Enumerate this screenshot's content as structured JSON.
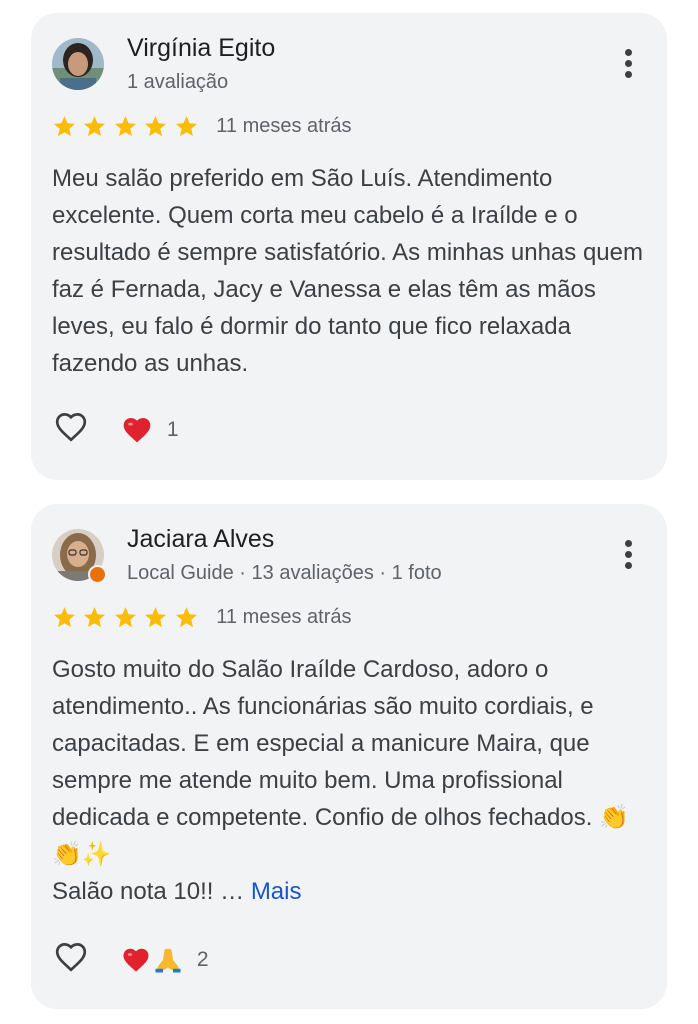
{
  "reviews": [
    {
      "author": "Virgínia Egito",
      "meta": "1 avaliação",
      "rating": 5,
      "date": "11 meses atrás",
      "text": "Meu salão preferido em São Luís. Atendimento excelente. Quem corta meu cabelo é a Iraílde e o resultado é sempre satisfatório. As minhas unhas quem faz é Fernada, Jacy e Vanessa e elas têm as mãos leves, eu falo é dormir do tanto que fico relaxada fazendo as unhas.",
      "reactions": [
        "red-heart"
      ],
      "reaction_count": "1",
      "icons": {
        "avatar": "user-avatar",
        "menu": "more-vert-icon",
        "like": "heart-outline-icon"
      }
    },
    {
      "author": "Jaciara Alves",
      "meta": "Local Guide · 13 avaliações · 1 foto",
      "rating": 5,
      "date": "11 meses atrás",
      "text_line1": "Gosto muito do Salão Iraílde Cardoso, adoro o atendimento.. As funcionárias são muito cordiais, e capacitadas. E em especial a manicure Maira, que sempre me atende muito bem. Uma profissional dedicada e competente. Confio de olhos fechados. 👏👏✨",
      "text_line2": "Salão nota 10!! …",
      "more_label": "Mais",
      "reactions": [
        "red-heart",
        "folded-hands"
      ],
      "reaction_count": "2",
      "local_guide_badge": true,
      "icons": {
        "avatar": "user-avatar",
        "menu": "more-vert-icon",
        "like": "heart-outline-icon"
      }
    }
  ],
  "colors": {
    "card_background": "#f1f3f5",
    "star": "#fbbc04",
    "secondary_text": "#5f6368",
    "link": "#1a56c8",
    "local_guide_badge": "#e8710a"
  }
}
